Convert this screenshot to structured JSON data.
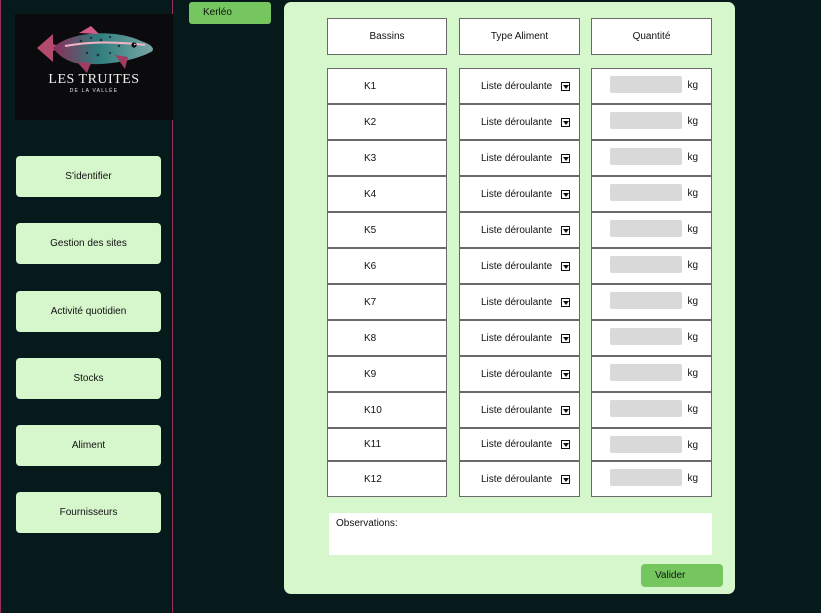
{
  "brand": {
    "title": "LES TRUITES",
    "subtitle": "DE LA VALLÉE",
    "logo_icon": "trout-fish-icon",
    "colors": {
      "sidebar_bg": "#061a1c",
      "accent": "#76c65f",
      "panel": "#d6f6cc"
    }
  },
  "sidebar": {
    "items": [
      {
        "label": "S'identifier"
      },
      {
        "label": "Gestion des sites"
      },
      {
        "label": "Activité quotidien"
      },
      {
        "label": "Stocks"
      },
      {
        "label": "Aliment"
      },
      {
        "label": "Fournisseurs"
      }
    ]
  },
  "site": {
    "name": "Kerléo"
  },
  "table": {
    "headers": [
      "Bassins",
      "Type Aliment",
      "Quantité"
    ],
    "rows": [
      {
        "bassin": "K1",
        "type": "Liste déroulante",
        "quantite": "",
        "unit": "kg"
      },
      {
        "bassin": "K2",
        "type": "Liste déroulante",
        "quantite": "",
        "unit": "kg"
      },
      {
        "bassin": "K3",
        "type": "Liste déroulante",
        "quantite": "",
        "unit": "kg"
      },
      {
        "bassin": "K4",
        "type": "Liste déroulante",
        "quantite": "",
        "unit": "kg"
      },
      {
        "bassin": "K5",
        "type": "Liste déroulante",
        "quantite": "",
        "unit": "kg"
      },
      {
        "bassin": "K6",
        "type": "Liste déroulante",
        "quantite": "",
        "unit": "kg"
      },
      {
        "bassin": "K7",
        "type": "Liste déroulante",
        "quantite": "",
        "unit": "kg"
      },
      {
        "bassin": "K8",
        "type": "Liste déroulante",
        "quantite": "",
        "unit": "kg"
      },
      {
        "bassin": "K9",
        "type": "Liste déroulante",
        "quantite": "",
        "unit": "kg"
      },
      {
        "bassin": "K10",
        "type": "Liste déroulante",
        "quantite": "",
        "unit": "kg"
      },
      {
        "bassin": "K11",
        "type": "Liste déroulante",
        "quantite": "",
        "unit": "kg"
      },
      {
        "bassin": "K12",
        "type": "Liste déroulante",
        "quantite": "",
        "unit": "kg"
      }
    ]
  },
  "observations": {
    "label": "Observations:"
  },
  "actions": {
    "submit_label": "Valider"
  }
}
